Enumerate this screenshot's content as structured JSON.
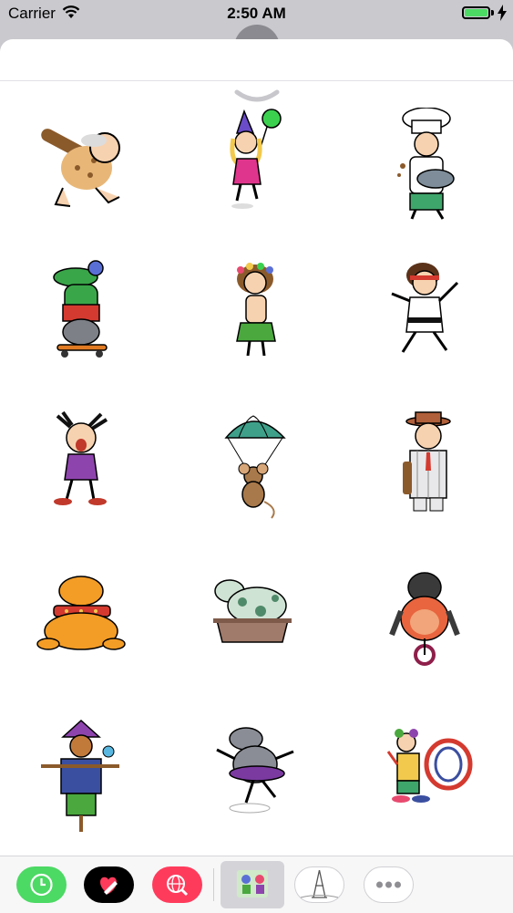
{
  "status_bar": {
    "carrier": "Carrier",
    "time": "2:50 AM",
    "battery_level": 1.0,
    "icons": [
      "wifi-icon",
      "battery-icon",
      "charging-bolt-icon"
    ]
  },
  "sheet": {
    "handle_icon": "chevron-down-icon",
    "stickers": [
      {
        "id": "caveman"
      },
      {
        "id": "party-girl-balloon"
      },
      {
        "id": "chef"
      },
      {
        "id": "crocodile-skateboard"
      },
      {
        "id": "hula-girl"
      },
      {
        "id": "karate-man"
      },
      {
        "id": "screaming-girl"
      },
      {
        "id": "parachute-mouse"
      },
      {
        "id": "gangster"
      },
      {
        "id": "bulldog"
      },
      {
        "id": "dog-in-pot"
      },
      {
        "id": "gorilla-unicycle"
      },
      {
        "id": "scarecrow"
      },
      {
        "id": "ballerina-hippo"
      },
      {
        "id": "drummer-clown"
      }
    ]
  },
  "app_tray": {
    "apps": [
      {
        "id": "recents",
        "icon": "clock-icon",
        "color": "#4cd964"
      },
      {
        "id": "digital-touch",
        "icon": "heart-hand-icon",
        "color": "#000000"
      },
      {
        "id": "images-search",
        "icon": "globe-search-icon",
        "color": "#ff3b5c"
      },
      {
        "id": "cartoon-stickers",
        "icon": "sticker-pack-icon",
        "selected": true
      },
      {
        "id": "paris-stickers",
        "icon": "eiffel-tower-icon"
      },
      {
        "id": "more",
        "icon": "more-icon"
      }
    ]
  }
}
